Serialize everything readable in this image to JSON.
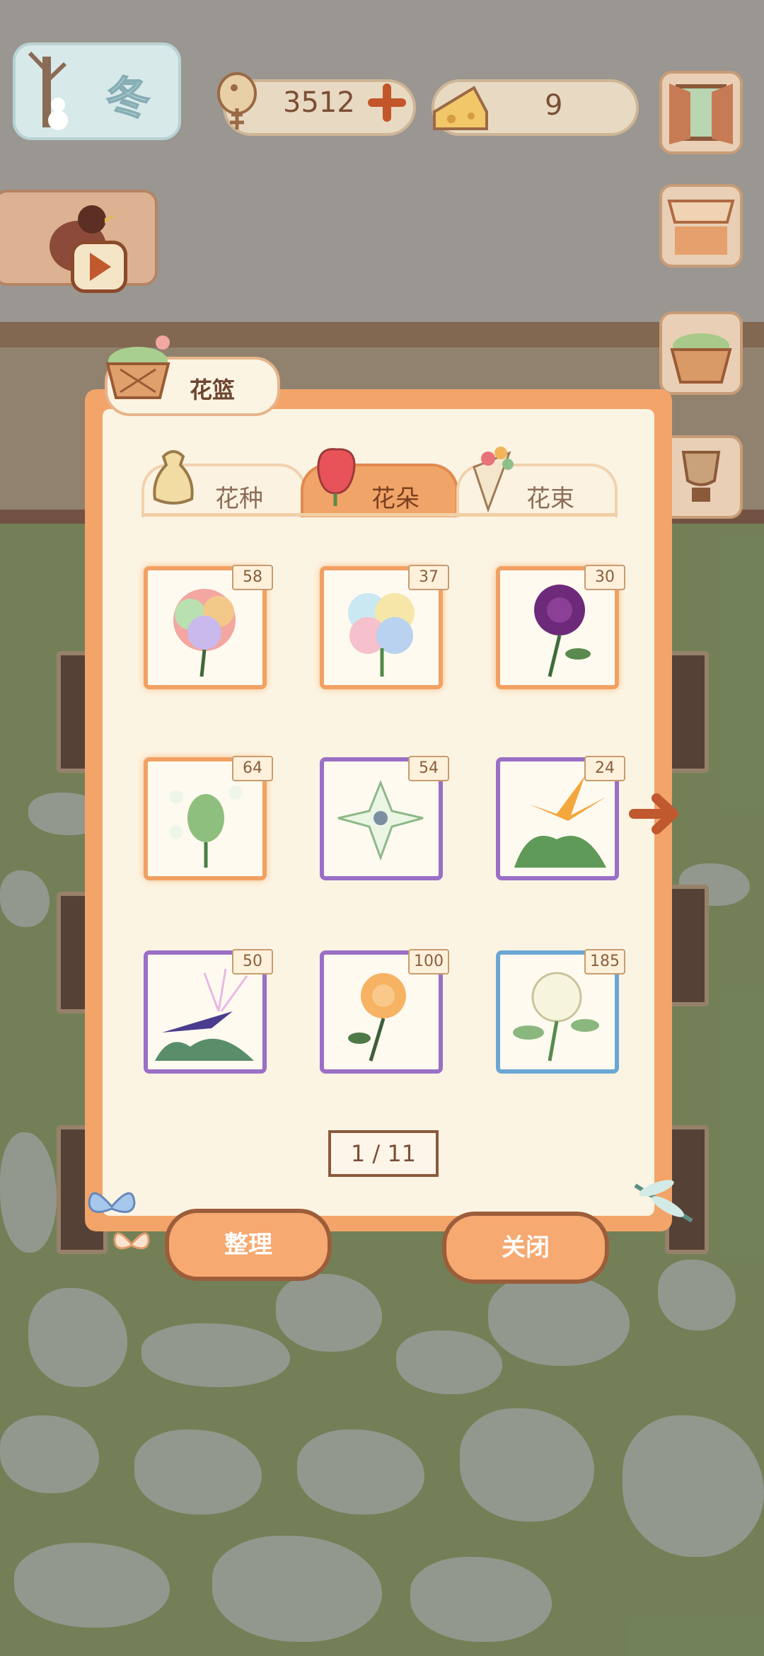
{
  "hud": {
    "season_label": "冬",
    "coins": "3512",
    "cheese": "9"
  },
  "dialog": {
    "title": "花篮",
    "tabs": [
      {
        "label": "花种",
        "active": false
      },
      {
        "label": "花朵",
        "active": true
      },
      {
        "label": "花束",
        "active": false
      }
    ],
    "items": [
      {
        "icon": "rainbow-rose",
        "count": "58",
        "rarity": "orange"
      },
      {
        "icon": "rainbow-pansy",
        "count": "37",
        "rarity": "orange"
      },
      {
        "icon": "purple-rose",
        "count": "30",
        "rarity": "orange"
      },
      {
        "icon": "green-flower-bud",
        "count": "64",
        "rarity": "orange"
      },
      {
        "icon": "white-lotus",
        "count": "54",
        "rarity": "purple"
      },
      {
        "icon": "bird-of-paradise",
        "count": "24",
        "rarity": "purple"
      },
      {
        "icon": "purple-bird-of-paradise",
        "count": "50",
        "rarity": "purple"
      },
      {
        "icon": "orange-rose",
        "count": "100",
        "rarity": "purple"
      },
      {
        "icon": "white-gardenia",
        "count": "185",
        "rarity": "blue"
      }
    ],
    "pager": "1 / 11",
    "buttons": {
      "sort": "整理",
      "close": "关闭"
    }
  },
  "colors": {
    "panel": "#f2a469",
    "orange_rarity": "#f1a163",
    "purple_rarity": "#9a6fc6",
    "blue_rarity": "#6ba7d4"
  }
}
